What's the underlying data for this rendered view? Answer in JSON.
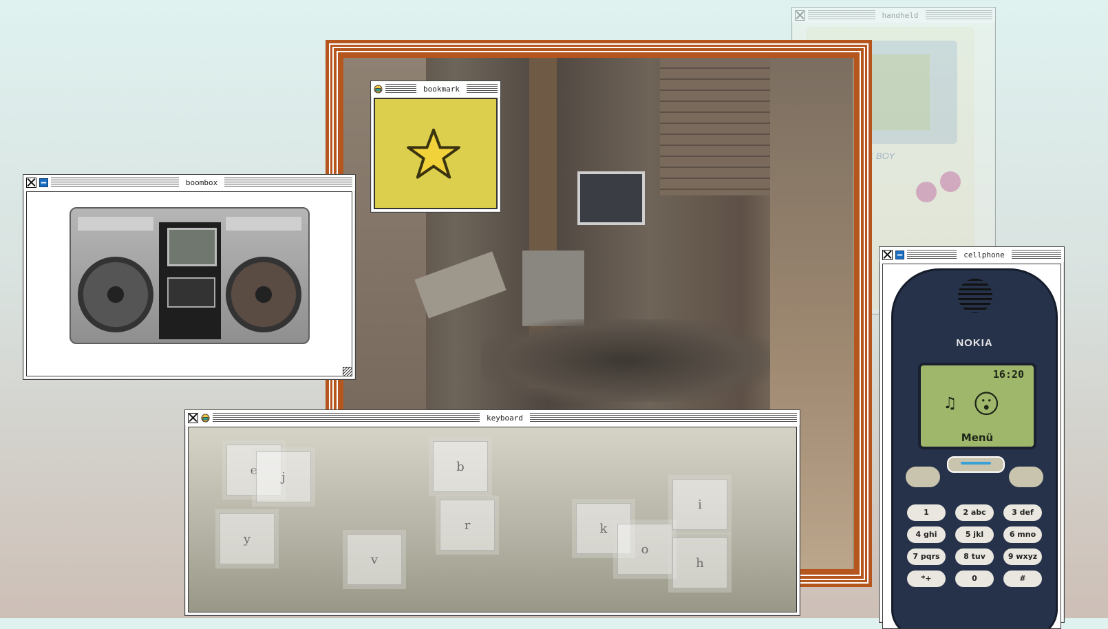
{
  "windows": {
    "boombox": {
      "title": "boombox"
    },
    "bookmark": {
      "title": "bookmark"
    },
    "keyboard": {
      "title": "keyboard"
    },
    "cellphone": {
      "title": "cellphone"
    },
    "handheld": {
      "title": "handheld"
    }
  },
  "keyboard_keys": [
    "e",
    "j",
    "b",
    "y",
    "r",
    "v",
    "k",
    "o",
    "i",
    "h"
  ],
  "phone": {
    "brand": "NOKIA",
    "time": "16:20",
    "menu": "Menü",
    "keys": [
      "1",
      "2 abc",
      "3 def",
      "4 ghi",
      "5 jkl",
      "6 mno",
      "7 pqrs",
      "8 tuv",
      "9 wxyz",
      "*+",
      "0",
      "#"
    ]
  },
  "gameboy_label": "GAME BOY",
  "colors": {
    "frame": "#b5561e",
    "bookmark_bg": "#dccf4d",
    "star": "#f2d23a",
    "phone_screen": "#9fb76b",
    "phone_body": "#26324a"
  }
}
